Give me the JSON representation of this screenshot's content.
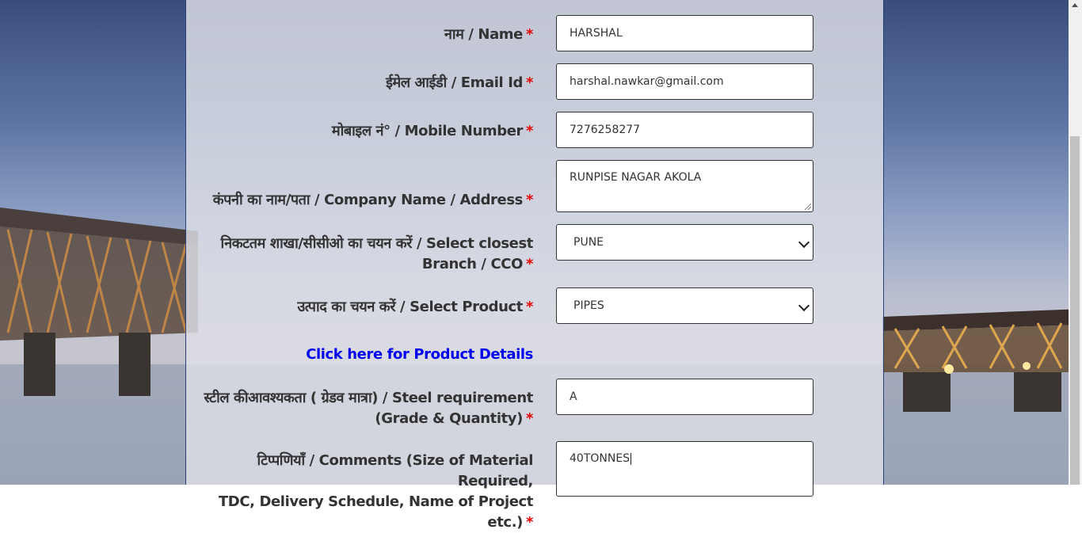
{
  "form": {
    "name": {
      "label": "नाम / Name",
      "value": "HARSHAL"
    },
    "email": {
      "label": "ईमेल आईडी / Email Id",
      "value": "harshal.nawkar@gmail.com"
    },
    "mobile": {
      "label": "मोबाइल नं° / Mobile Number",
      "value": "7276258277"
    },
    "company": {
      "label": "कंपनी का नाम/पता / Company Name / Address",
      "value": "RUNPISE NAGAR AKOLA"
    },
    "branch": {
      "label_line1": "निकटतम शाखा/सीसीओ का चयन करें / Select closest",
      "label_line2": "Branch / CCO",
      "value": "PUNE"
    },
    "product": {
      "label": "उत्पाद का चयन करें / Select Product",
      "value": "PIPES"
    },
    "product_link": "Click here for Product Details",
    "steel": {
      "label_line1": "स्टील कीआवश्यकता ( ग्रेडव मात्रा) / Steel requirement",
      "label_line2": "(Grade & Quantity)",
      "value": "A"
    },
    "comments": {
      "label_line1": "टिप्पणियाँ / Comments (Size of Material Required,",
      "label_line2": "TDC, Delivery Schedule, Name of Project etc.)",
      "value": "40TONNES"
    },
    "required_marker": "*"
  },
  "icons": {
    "select_arrow": "chevron-down-icon",
    "resize": "resize-handle-icon",
    "scroll_up": "scroll-up-icon"
  },
  "colors": {
    "required": "#e60000",
    "link": "#0000ee",
    "panel_border": "#2b3f7a"
  }
}
